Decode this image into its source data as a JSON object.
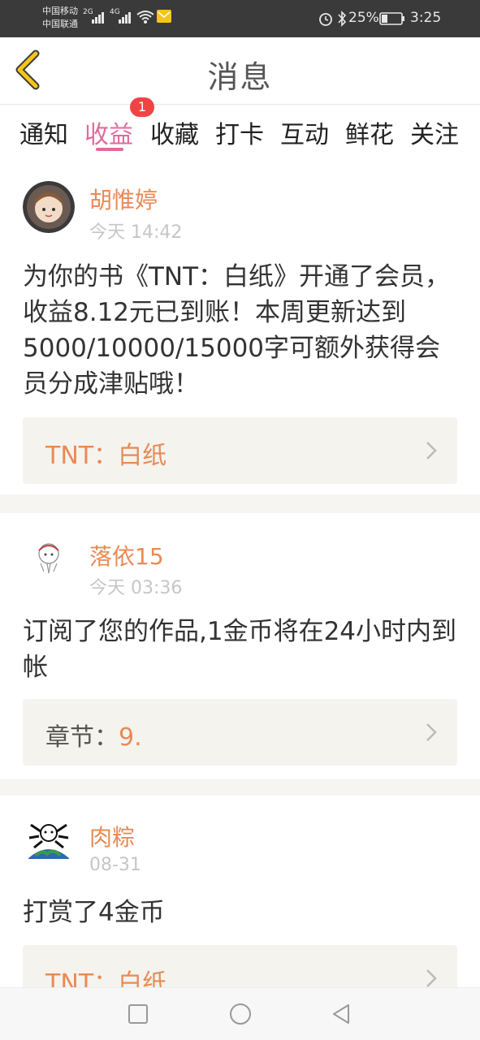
{
  "status_bar": {
    "carrier1": "中国移动",
    "carrier2": "中国联通",
    "net1": "2G",
    "net2": "4G",
    "battery": "25%",
    "time": "3:25"
  },
  "header": {
    "title": "消息"
  },
  "tabs": [
    {
      "label": "通知"
    },
    {
      "label": "收益",
      "active": true,
      "badge": "1"
    },
    {
      "label": "收藏"
    },
    {
      "label": "打卡"
    },
    {
      "label": "互动"
    },
    {
      "label": "鲜花"
    },
    {
      "label": "关注"
    }
  ],
  "messages": [
    {
      "name": "胡惟婷",
      "date": "今天 14:42",
      "text": "为你的书《TNT：白纸》开通了会员，收益8.12元已到账！本周更新达到5000/10000/15000字可额外获得会员分成津贴哦！",
      "link_label": "",
      "link_value": "TNT：白纸"
    },
    {
      "name": "落依15",
      "date": "今天 03:36",
      "text": "订阅了您的作品,1金币将在24小时内到帐",
      "link_label": "章节：",
      "link_value": "9."
    },
    {
      "name": "肉粽",
      "date": "08-31",
      "text": "打赏了4金币",
      "link_label": "",
      "link_value": "TNT：白纸"
    }
  ],
  "colors": {
    "accent": "#e06a9a",
    "name": "#e88a55",
    "badge": "#f04444"
  }
}
